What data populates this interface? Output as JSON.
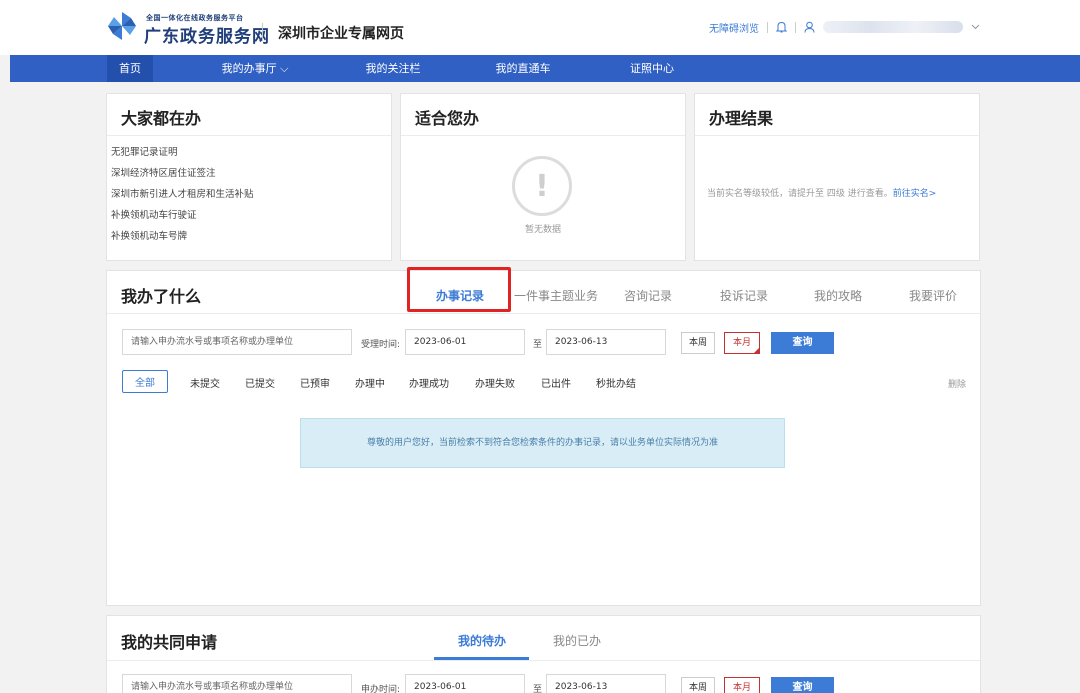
{
  "header": {
    "platform_small": "全国一体化在线政务服务平台",
    "platform_main": "广东政务服务网",
    "subtitle": "深圳市企业专属网页",
    "accessibility": "无障碍浏览"
  },
  "nav": {
    "items": [
      "首页",
      "我的办事厅 ⌵",
      "我的关注栏",
      "我的直通车",
      "证照中心"
    ]
  },
  "popular": {
    "title": "大家都在办",
    "items": [
      "无犯罪记录证明",
      "深圳经济特区居住证签注",
      "深圳市新引进人才租房和生活补贴",
      "补换领机动车行驶证",
      "补换领机动车号牌"
    ]
  },
  "suitable": {
    "title": "适合您办",
    "empty_text": "暂无数据"
  },
  "results": {
    "title": "办理结果",
    "message": "当前实名等级较低，请提升至 四级 进行查看。",
    "link": "前往实名>"
  },
  "records": {
    "title": "我办了什么",
    "tabs": [
      "办事记录",
      "一件事主题业务",
      "咨询记录",
      "投诉记录",
      "我的攻略",
      "我要评价"
    ],
    "search_placeholder": "请输入申办流水号或事项名称或办理单位",
    "time_label": "受理时间:",
    "date_from": "2023-06-01",
    "to_label": "至",
    "date_to": "2023-06-13",
    "btn_week": "本周",
    "btn_month": "本月",
    "btn_query": "查询",
    "filters": [
      "全部",
      "未提交",
      "已提交",
      "已预审",
      "办理中",
      "办理成功",
      "办理失败",
      "已出件",
      "秒批办结"
    ],
    "delete": "删除",
    "notice": "尊敬的用户您好，当前检索不到符合您检索条件的办事记录，请以业务单位实际情况为准"
  },
  "joint": {
    "title": "我的共同申请",
    "tabs": [
      "我的待办",
      "我的已办"
    ],
    "search_placeholder": "请输入申办流水号或事项名称或办理单位",
    "time_label": "申办时间:",
    "date_from": "2023-06-01",
    "to_label": "至",
    "date_to": "2023-06-13",
    "btn_week": "本周",
    "btn_month": "本月",
    "btn_query": "查询"
  }
}
